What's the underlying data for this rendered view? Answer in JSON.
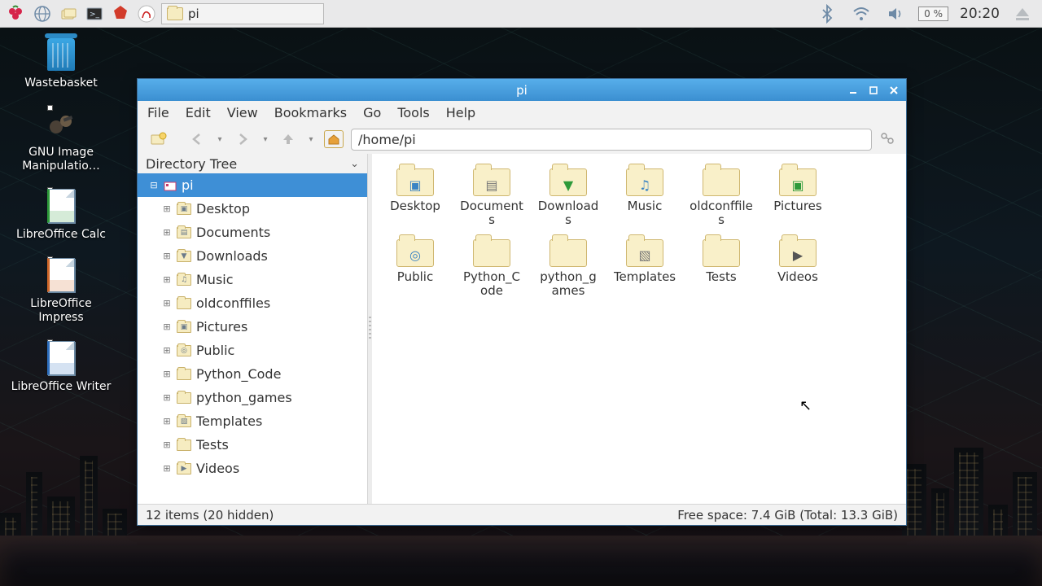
{
  "taskbar": {
    "task_button_label": "pi",
    "cpu_label": "0 %",
    "clock": "20:20"
  },
  "desktop_icons": [
    {
      "name": "wastebasket",
      "label": "Wastebasket",
      "kind": "trash"
    },
    {
      "name": "gimp",
      "label": "GNU Image Manipulatio…",
      "kind": "app"
    },
    {
      "name": "lo-calc",
      "label": "LibreOffice Calc",
      "kind": "doc",
      "accent": "#2e9a3a"
    },
    {
      "name": "lo-impress",
      "label": "LibreOffice Impress",
      "kind": "doc",
      "accent": "#d1682a"
    },
    {
      "name": "lo-writer",
      "label": "LibreOffice Writer",
      "kind": "doc",
      "accent": "#2e6fbf"
    }
  ],
  "window": {
    "title": "pi",
    "menus": [
      "File",
      "Edit",
      "View",
      "Bookmarks",
      "Go",
      "Tools",
      "Help"
    ],
    "path": "/home/pi",
    "side_header": "Directory Tree",
    "tree_root": "pi",
    "tree": [
      {
        "label": "Desktop",
        "glyph": "▣"
      },
      {
        "label": "Documents",
        "glyph": "▤"
      },
      {
        "label": "Downloads",
        "glyph": "▼"
      },
      {
        "label": "Music",
        "glyph": "♫"
      },
      {
        "label": "oldconffiles",
        "glyph": ""
      },
      {
        "label": "Pictures",
        "glyph": "▣"
      },
      {
        "label": "Public",
        "glyph": "◎"
      },
      {
        "label": "Python_Code",
        "glyph": ""
      },
      {
        "label": "python_games",
        "glyph": ""
      },
      {
        "label": "Templates",
        "glyph": "▧"
      },
      {
        "label": "Tests",
        "glyph": ""
      },
      {
        "label": "Videos",
        "glyph": "▶"
      }
    ],
    "items": [
      {
        "label": "Desktop",
        "glyph": "▣",
        "glyph_color": "#3b84c4"
      },
      {
        "label": "Documents",
        "glyph": "▤",
        "glyph_color": "#777"
      },
      {
        "label": "Downloads",
        "glyph": "▼",
        "glyph_color": "#2e9a3a"
      },
      {
        "label": "Music",
        "glyph": "♫",
        "glyph_color": "#3b84c4"
      },
      {
        "label": "oldconffiles",
        "glyph": "",
        "glyph_color": "#777"
      },
      {
        "label": "Pictures",
        "glyph": "▣",
        "glyph_color": "#2e9a3a"
      },
      {
        "label": "Public",
        "glyph": "◎",
        "glyph_color": "#3b84c4"
      },
      {
        "label": "Python_Code",
        "glyph": "",
        "glyph_color": "#777"
      },
      {
        "label": "python_games",
        "glyph": "",
        "glyph_color": "#777"
      },
      {
        "label": "Templates",
        "glyph": "▧",
        "glyph_color": "#777"
      },
      {
        "label": "Tests",
        "glyph": "",
        "glyph_color": "#777"
      },
      {
        "label": "Videos",
        "glyph": "▶",
        "glyph_color": "#555"
      }
    ],
    "status_left": "12 items (20 hidden)",
    "status_right": "Free space: 7.4 GiB (Total: 13.3 GiB)"
  }
}
